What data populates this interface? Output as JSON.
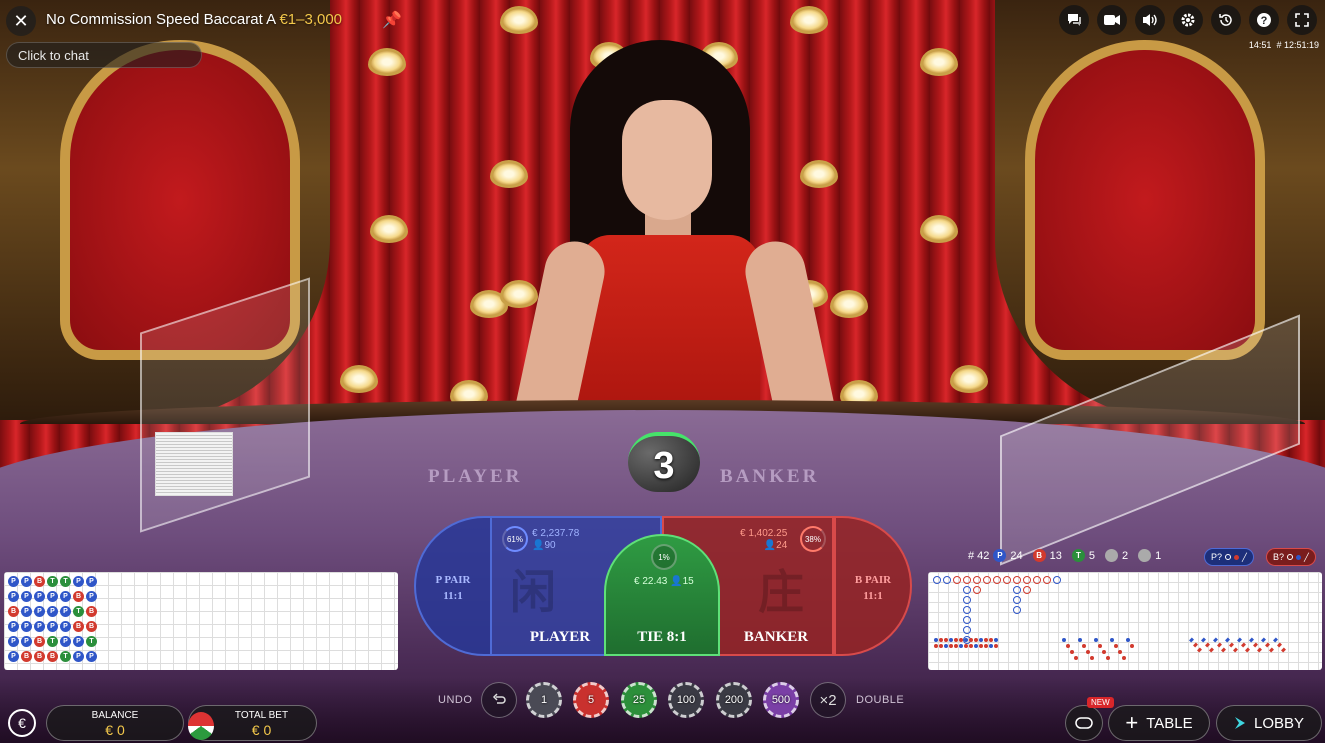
{
  "header": {
    "title": "No Commission Speed Baccarat A",
    "limits": "€1–3,000",
    "chat_placeholder": "Click to chat",
    "time": "14:51",
    "round_id": "# 12:51:19"
  },
  "top_icons": [
    "chat-icon",
    "video-icon",
    "sound-icon",
    "settings-icon",
    "history-icon",
    "help-icon",
    "fullscreen-icon"
  ],
  "table": {
    "felt_player": "PLAYER",
    "felt_banker": "BANKER",
    "countdown": "3"
  },
  "bets": {
    "player_pair": {
      "label": "P PAIR",
      "payout": "11:1"
    },
    "player": {
      "label": "PLAYER",
      "percent": "61%",
      "amount": "€ 2,237.78",
      "players": "90",
      "glyph": "闲"
    },
    "tie": {
      "label": "TIE 8:1",
      "percent": "1%",
      "amount": "€ 22.43",
      "players": "15"
    },
    "banker": {
      "label": "BANKER",
      "percent": "38%",
      "amount": "€ 1,402.25",
      "players": "24",
      "glyph": "庄"
    },
    "banker_pair": {
      "label": "B PAIR",
      "payout": "11:1"
    }
  },
  "stats": {
    "rounds": "# 42",
    "player_letter": "P",
    "player_wins": "24",
    "banker_letter": "B",
    "banker_wins": "13",
    "tie_letter": "T",
    "ties": "5",
    "player_pairs": "2",
    "banker_pairs": "1",
    "predict_player": "P?",
    "predict_banker": "B?"
  },
  "bead_road": [
    [
      "P",
      "P",
      "B",
      "T",
      "T",
      "P",
      "P"
    ],
    [
      "P",
      "P",
      "P",
      "P",
      "P",
      "B",
      "P"
    ],
    [
      "B",
      "P",
      "P",
      "P",
      "P",
      "T",
      "B"
    ],
    [
      "P",
      "P",
      "P",
      "P",
      "P",
      "B",
      "B"
    ],
    [
      "P",
      "P",
      "B",
      "T",
      "P",
      "P",
      "T"
    ],
    [
      "P",
      "B",
      "B",
      "B",
      "T",
      "P",
      "P"
    ]
  ],
  "colors": {
    "player": "#2f56c8",
    "banker": "#d23a2e",
    "tie": "#2b8f3c",
    "gold": "#f3c84b"
  },
  "bottom": {
    "balance_label": "BALANCE",
    "balance_value": "€ 0",
    "total_bet_label": "TOTAL BET",
    "total_bet_value": "€ 0",
    "undo": "UNDO",
    "double": "DOUBLE",
    "double_symbol": "×2",
    "chips": [
      "1",
      "5",
      "25",
      "100",
      "200",
      "500"
    ],
    "new_badge": "NEW",
    "table_label": "TABLE",
    "lobby_label": "LOBBY"
  }
}
